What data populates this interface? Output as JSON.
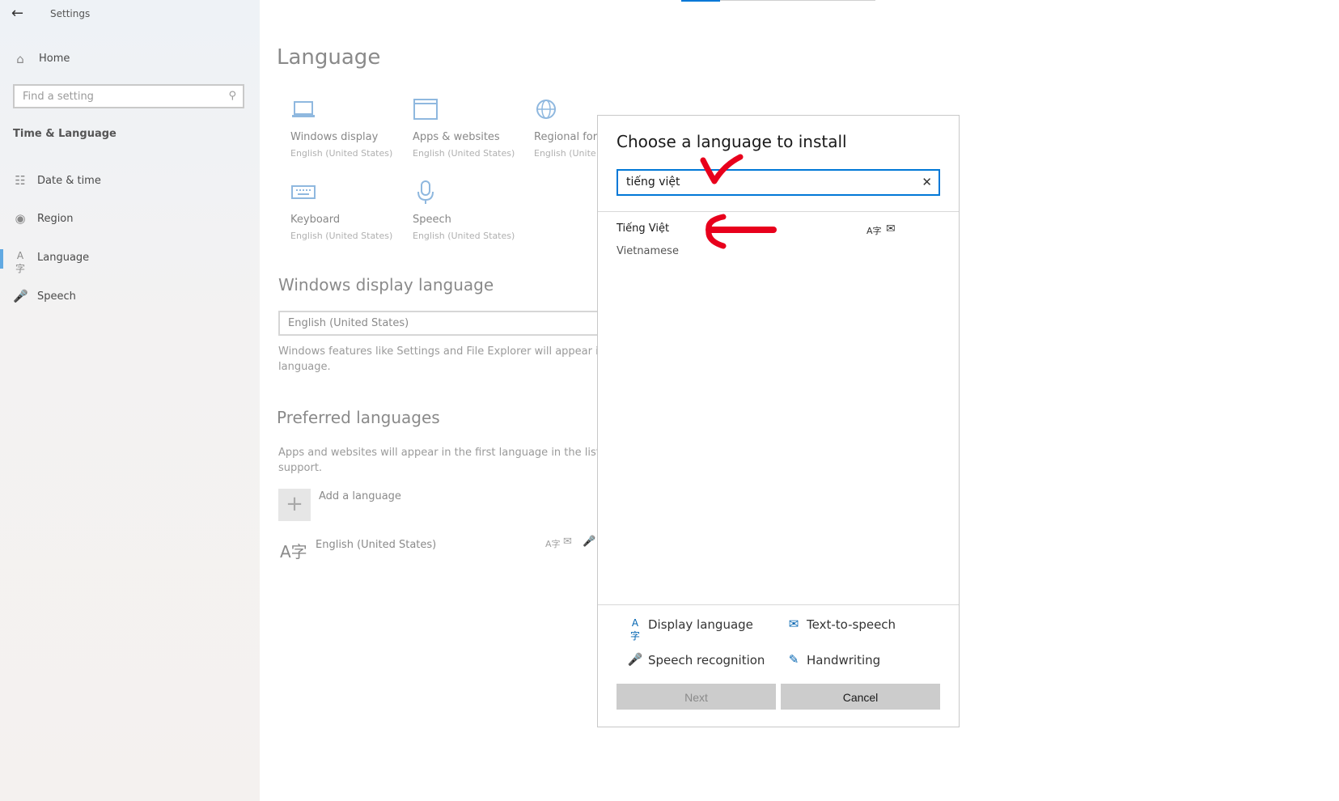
{
  "window": {
    "title": "Settings"
  },
  "sidebar": {
    "home_label": "Home",
    "search_placeholder": "Find a setting",
    "section_title": "Time & Language",
    "items": [
      {
        "label": "Date & time",
        "icon": "calendar-clock-icon"
      },
      {
        "label": "Region",
        "icon": "globe-icon"
      },
      {
        "label": "Language",
        "icon": "language-icon",
        "active": true
      },
      {
        "label": "Speech",
        "icon": "microphone-icon"
      }
    ]
  },
  "main": {
    "page_title": "Language",
    "tiles": [
      {
        "title": "Windows display",
        "subtitle": "English (United States)",
        "icon": "laptop-icon"
      },
      {
        "title": "Apps & websites",
        "subtitle": "English (United States)",
        "icon": "window-icon"
      },
      {
        "title": "Regional for",
        "subtitle": "English (Unite",
        "icon": "globe-icon"
      },
      {
        "title": "Keyboard",
        "subtitle": "English (United States)",
        "icon": "keyboard-icon"
      },
      {
        "title": "Speech",
        "subtitle": "English (United States)",
        "icon": "microphone-icon"
      }
    ],
    "display_language": {
      "heading": "Windows display language",
      "selected": "English (United States)",
      "description_line1": "Windows features like Settings and File Explorer will appear in th",
      "description_line2": "language."
    },
    "preferred": {
      "heading": "Preferred languages",
      "description_line1": "Apps and websites will appear in the first language in the list tha",
      "description_line2": "support.",
      "add_label": "Add a language",
      "languages": [
        {
          "name": "English (United States)"
        }
      ]
    }
  },
  "dialog": {
    "title": "Choose a language to install",
    "search_value": "tiếng việt",
    "results": [
      {
        "native": "Tiếng Việt",
        "english": "Vietnamese"
      }
    ],
    "legend": [
      {
        "label": "Display language",
        "icon": "display-language-icon"
      },
      {
        "label": "Text-to-speech",
        "icon": "text-to-speech-icon"
      },
      {
        "label": "Speech recognition",
        "icon": "microphone-icon"
      },
      {
        "label": "Handwriting",
        "icon": "handwriting-icon"
      }
    ],
    "next_label": "Next",
    "cancel_label": "Cancel"
  },
  "colors": {
    "accent": "#0078d7",
    "annotation": "#e8001c"
  }
}
